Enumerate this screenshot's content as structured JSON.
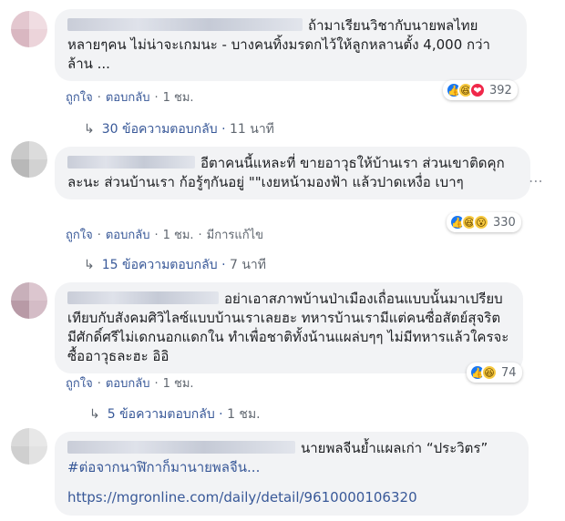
{
  "comments": [
    {
      "text": "ถ้ามาเรียนวิชากับนายพลไทย หลายๆคน ไม่น่าจะเกมนะ - บางคนทิ้งมรดกไว้ให้ลูกหลานตั้ง 4,000 กว่าล้าน ...",
      "actions": {
        "like": "ถูกใจ",
        "reply": "ตอบกลับ",
        "time": "1 ชม.",
        "edited": ""
      },
      "reactions": {
        "icons": [
          "like-icon",
          "haha-icon",
          "love-icon"
        ],
        "count": "392"
      },
      "replies": {
        "label": "30 ข้อความตอบกลับ",
        "time": "11 นาที"
      }
    },
    {
      "text": "อีตาคนนี้แหละที่ ขายอาวุธให้บ้านเรา ส่วนเขาติดคุกละนะ ส่วนบ้านเรา ก้อรู้ๆกันอยู่ \"\"เงยหน้ามองฟ้า แล้วปาดเหงื่อ เบาๆ",
      "actions": {
        "like": "ถูกใจ",
        "reply": "ตอบกลับ",
        "time": "1 ชม.",
        "edited": "มีการแก้ไข"
      },
      "reactions": {
        "icons": [
          "like-icon",
          "haha-icon",
          "wow-icon"
        ],
        "count": "330"
      },
      "replies": {
        "label": "15 ข้อความตอบกลับ",
        "time": "7 นาที"
      }
    },
    {
      "text": "อย่าเอาสภาพบ้านป่าเมืองเถื่อนแบบนั้นมาเปรียบเทียบกับสังคมศิวิไลซ์แบบบ้านเราเลยฮะ ทหารบ้านเรามีแต่คนซื่อสัตย์สุจริต มีศักดิ์ศรีไม่เดกนอกแดกใน ทำเพื่อชาติทั้งน้านแผล่บๆๆ ไม่มีทหารแล้วใครจะซื้ออาวุธละฮะ อิอิ",
      "actions": {
        "like": "ถูกใจ",
        "reply": "ตอบกลับ",
        "time": "1 ชม.",
        "edited": ""
      },
      "reactions": {
        "icons": [
          "like-icon",
          "haha-icon"
        ],
        "count": "74"
      },
      "replies": {
        "label": "5 ข้อความตอบกลับ",
        "time": "1 ชม."
      }
    },
    {
      "text": "นายพลจีนย้ำแผลเก่า “ประวิตร”",
      "hashtag": "#ต่อจากนาฬิกาก็มานายพลจีน...",
      "link": "https://mgronline.com/daily/detail/9610000106320"
    }
  ],
  "more_icon": "more-options-icon",
  "colors": {
    "link": "#385898",
    "bubble": "#f2f3f5",
    "meta": "#606770"
  }
}
